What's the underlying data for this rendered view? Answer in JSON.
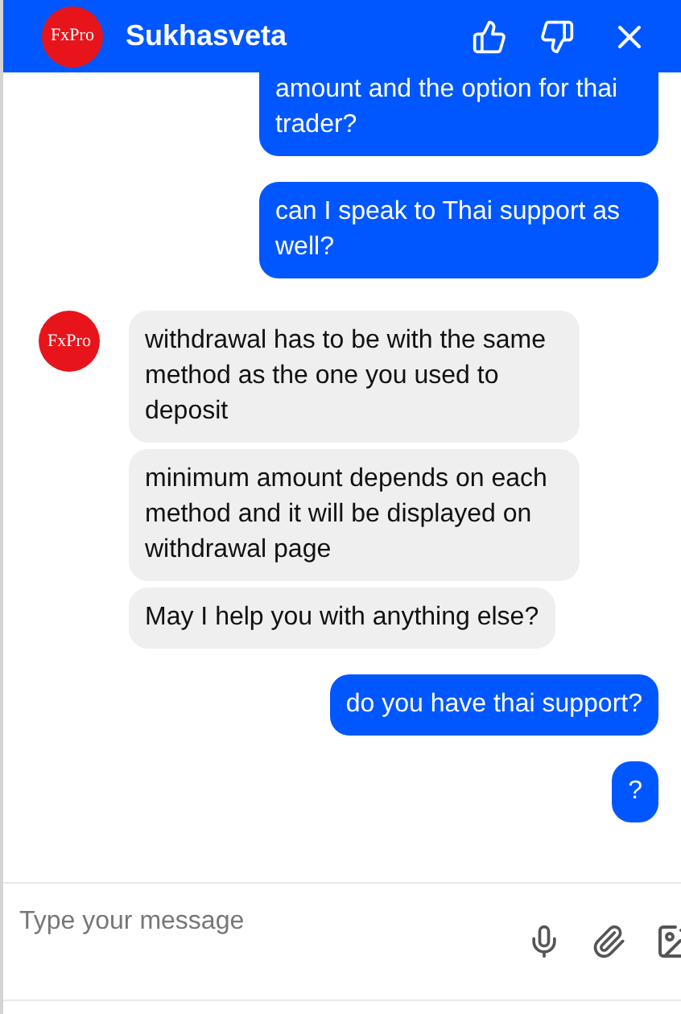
{
  "header": {
    "logo": "FxPro",
    "title": "Sukhasveta"
  },
  "messages": [
    {
      "kind": "user",
      "texts": [
        "amount and the option for thai trader?"
      ],
      "cut_top": true
    },
    {
      "kind": "user",
      "texts": [
        "can I speak to Thai support as well?"
      ]
    },
    {
      "kind": "agent",
      "logo": "FxPro",
      "texts": [
        "withdrawal has to be with the same method as the one you used to deposit",
        "minimum amount depends on each method and it will be displayed on withdrawal page",
        "May I help you with anything else?"
      ]
    },
    {
      "kind": "user",
      "texts": [
        "do you have thai support?"
      ]
    },
    {
      "kind": "user",
      "texts": [
        "?"
      ]
    }
  ],
  "composer": {
    "placeholder": "Type your message"
  }
}
